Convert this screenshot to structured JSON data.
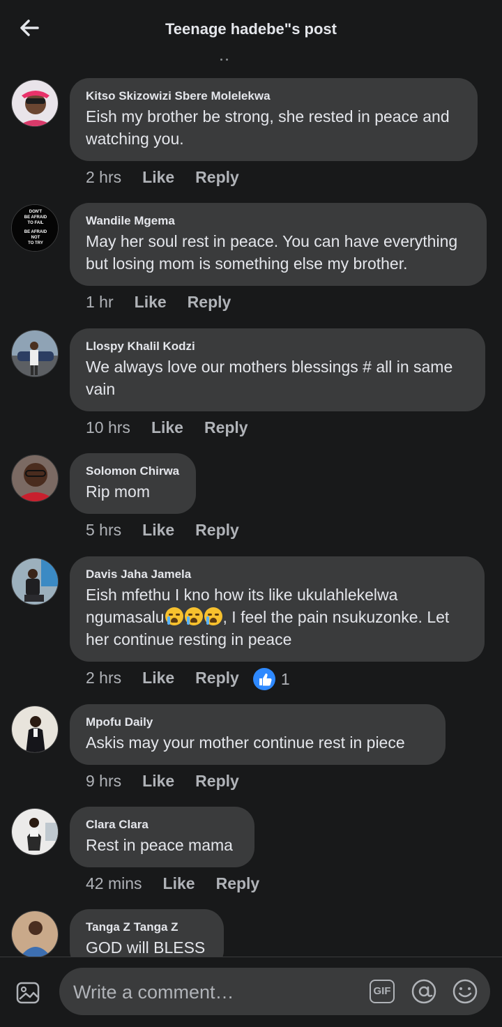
{
  "header": {
    "title": "Teenage hadebe\"s post",
    "back_icon": "arrow-left-icon"
  },
  "comments": [
    {
      "author": "Kitso Skizowizi Sbere Molelekwa",
      "text": "Eish my brother be strong, she rested in peace and watching you.",
      "time": "2 hrs",
      "like": "Like",
      "reply": "Reply"
    },
    {
      "author": "Wandile Mgema",
      "text": "May her soul rest in peace. You can have everything but losing mom is something else my brother.",
      "time": "1 hr",
      "like": "Like",
      "reply": "Reply",
      "avatar_text": [
        "DON'T",
        "BE AFRAID",
        "TO FAIL",
        "BE AFRAID",
        "NOT",
        "TO TRY"
      ]
    },
    {
      "author": "Llospy Khalil Kodzi",
      "text": "We always love our mothers blessings # all in same vain",
      "time": "10 hrs",
      "like": "Like",
      "reply": "Reply"
    },
    {
      "author": "Solomon Chirwa",
      "text": "Rip mom",
      "time": "5 hrs",
      "like": "Like",
      "reply": "Reply"
    },
    {
      "author": "Davis Jaha Jamela",
      "text_part1": "Eish mfethu I kno how its like ukulahlekelwa ngumasalu",
      "emoji": "loudly-crying-face-icon",
      "text_part2": ", I feel the pain nsukuzonke. Let her continue resting in peace",
      "time": "2 hrs",
      "like": "Like",
      "reply": "Reply",
      "reaction_count": "1"
    },
    {
      "author": "Mpofu Daily",
      "text": "Askis  may your mother continue  rest in piece",
      "time": "9 hrs",
      "like": "Like",
      "reply": "Reply"
    },
    {
      "author": "Clara Clara",
      "text": "Rest in peace mama",
      "time": "42 mins",
      "like": "Like",
      "reply": "Reply"
    },
    {
      "author": "Tanga Z Tanga Z",
      "text": "GOD will  BLESS"
    }
  ],
  "composer": {
    "placeholder": "Write a comment…",
    "gif_label": "GIF"
  },
  "colors": {
    "background": "#18191a",
    "bubble": "#3a3b3c",
    "text": "#e4e6eb",
    "muted": "#b0b3b8",
    "like_blue": "#2e89ff"
  }
}
